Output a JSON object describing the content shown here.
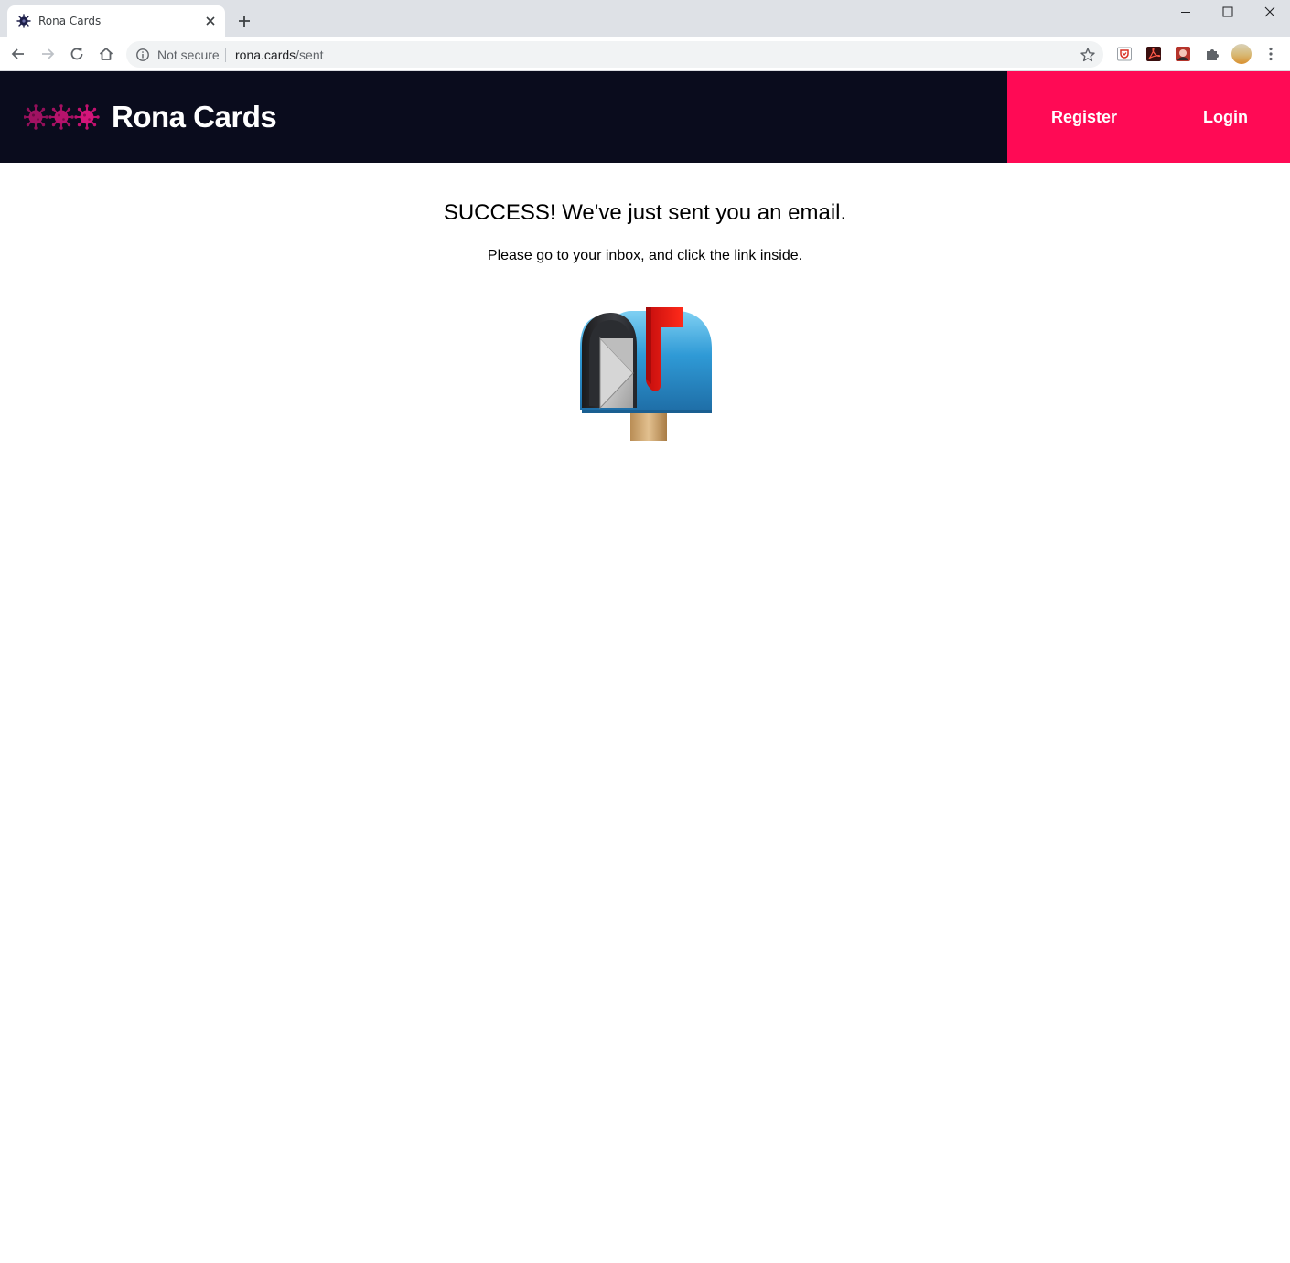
{
  "browser": {
    "tab": {
      "title": "Rona Cards",
      "favicon": "virus-icon"
    },
    "address": {
      "security_label": "Not secure",
      "host": "rona.cards",
      "path": "/sent"
    },
    "extensions": [
      "shield-extension-icon",
      "acrobat-extension-icon",
      "photo-extension-icon",
      "puzzle-extensions-icon"
    ]
  },
  "header": {
    "brand": "Rona Cards",
    "logo": "three-virus-icons",
    "nav": {
      "register": "Register",
      "login": "Login"
    }
  },
  "main": {
    "headline": "SUCCESS! We've just sent you an email.",
    "subline": "Please go to your inbox, and click the link inside.",
    "illustration": "mailbox-with-raised-flag-icon"
  },
  "colors": {
    "header_bg": "#0a0c1d",
    "nav_bg": "#ff0a55",
    "virus_magenta": "#c0116e"
  }
}
